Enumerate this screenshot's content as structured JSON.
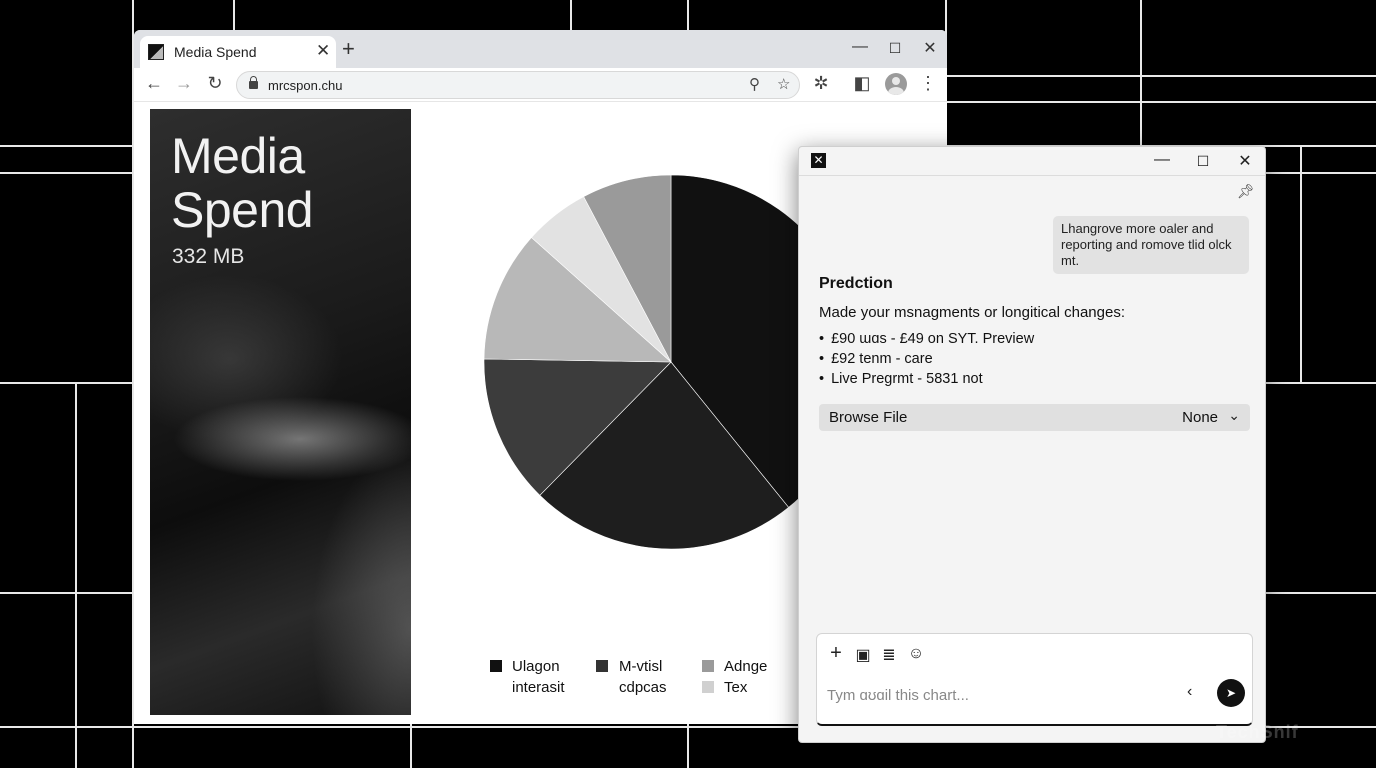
{
  "browser": {
    "tab_title": "Media Spend",
    "url": "mrcspon.chu"
  },
  "page": {
    "cover_title": "Media Spend",
    "cover_subtitle": "332 MB"
  },
  "chart_data": {
    "type": "pie",
    "slices": [
      {
        "value": 38.0,
        "color": "#111111"
      },
      {
        "value": 22.5,
        "color": "#1e1e1e"
      },
      {
        "value": 12.5,
        "color": "#3c3c3c"
      },
      {
        "value": 11.0,
        "color": "#b8b8b8"
      },
      {
        "value": 5.5,
        "color": "#e2e2e2"
      },
      {
        "value": 7.5,
        "color": "#9a9a9a"
      }
    ],
    "legend": [
      {
        "label": "Ulagon interasit",
        "color": "#111111"
      },
      {
        "label": "M-vtisl cdpcas",
        "color": "#333333"
      },
      {
        "label": "Adnge",
        "color": "#9a9a9a"
      },
      {
        "label": "Tex",
        "color": "#d0d0d0"
      }
    ]
  },
  "assistant": {
    "user_message": "Lhangrove more oaler and reporting and romove tlid olck mt.",
    "heading": "Predction",
    "intro": "Made your msnagments or longitical changes:",
    "items": [
      "£90 ɯɑs - £49 on SYT. Preview",
      "£92 tenm - care",
      "Live Pregrmt - 5831 not"
    ],
    "browse_label": "Browse File",
    "browse_value": "None",
    "input_placeholder": "Tym ɑʊɑil this chart..."
  },
  "watermark": "TechSnif"
}
